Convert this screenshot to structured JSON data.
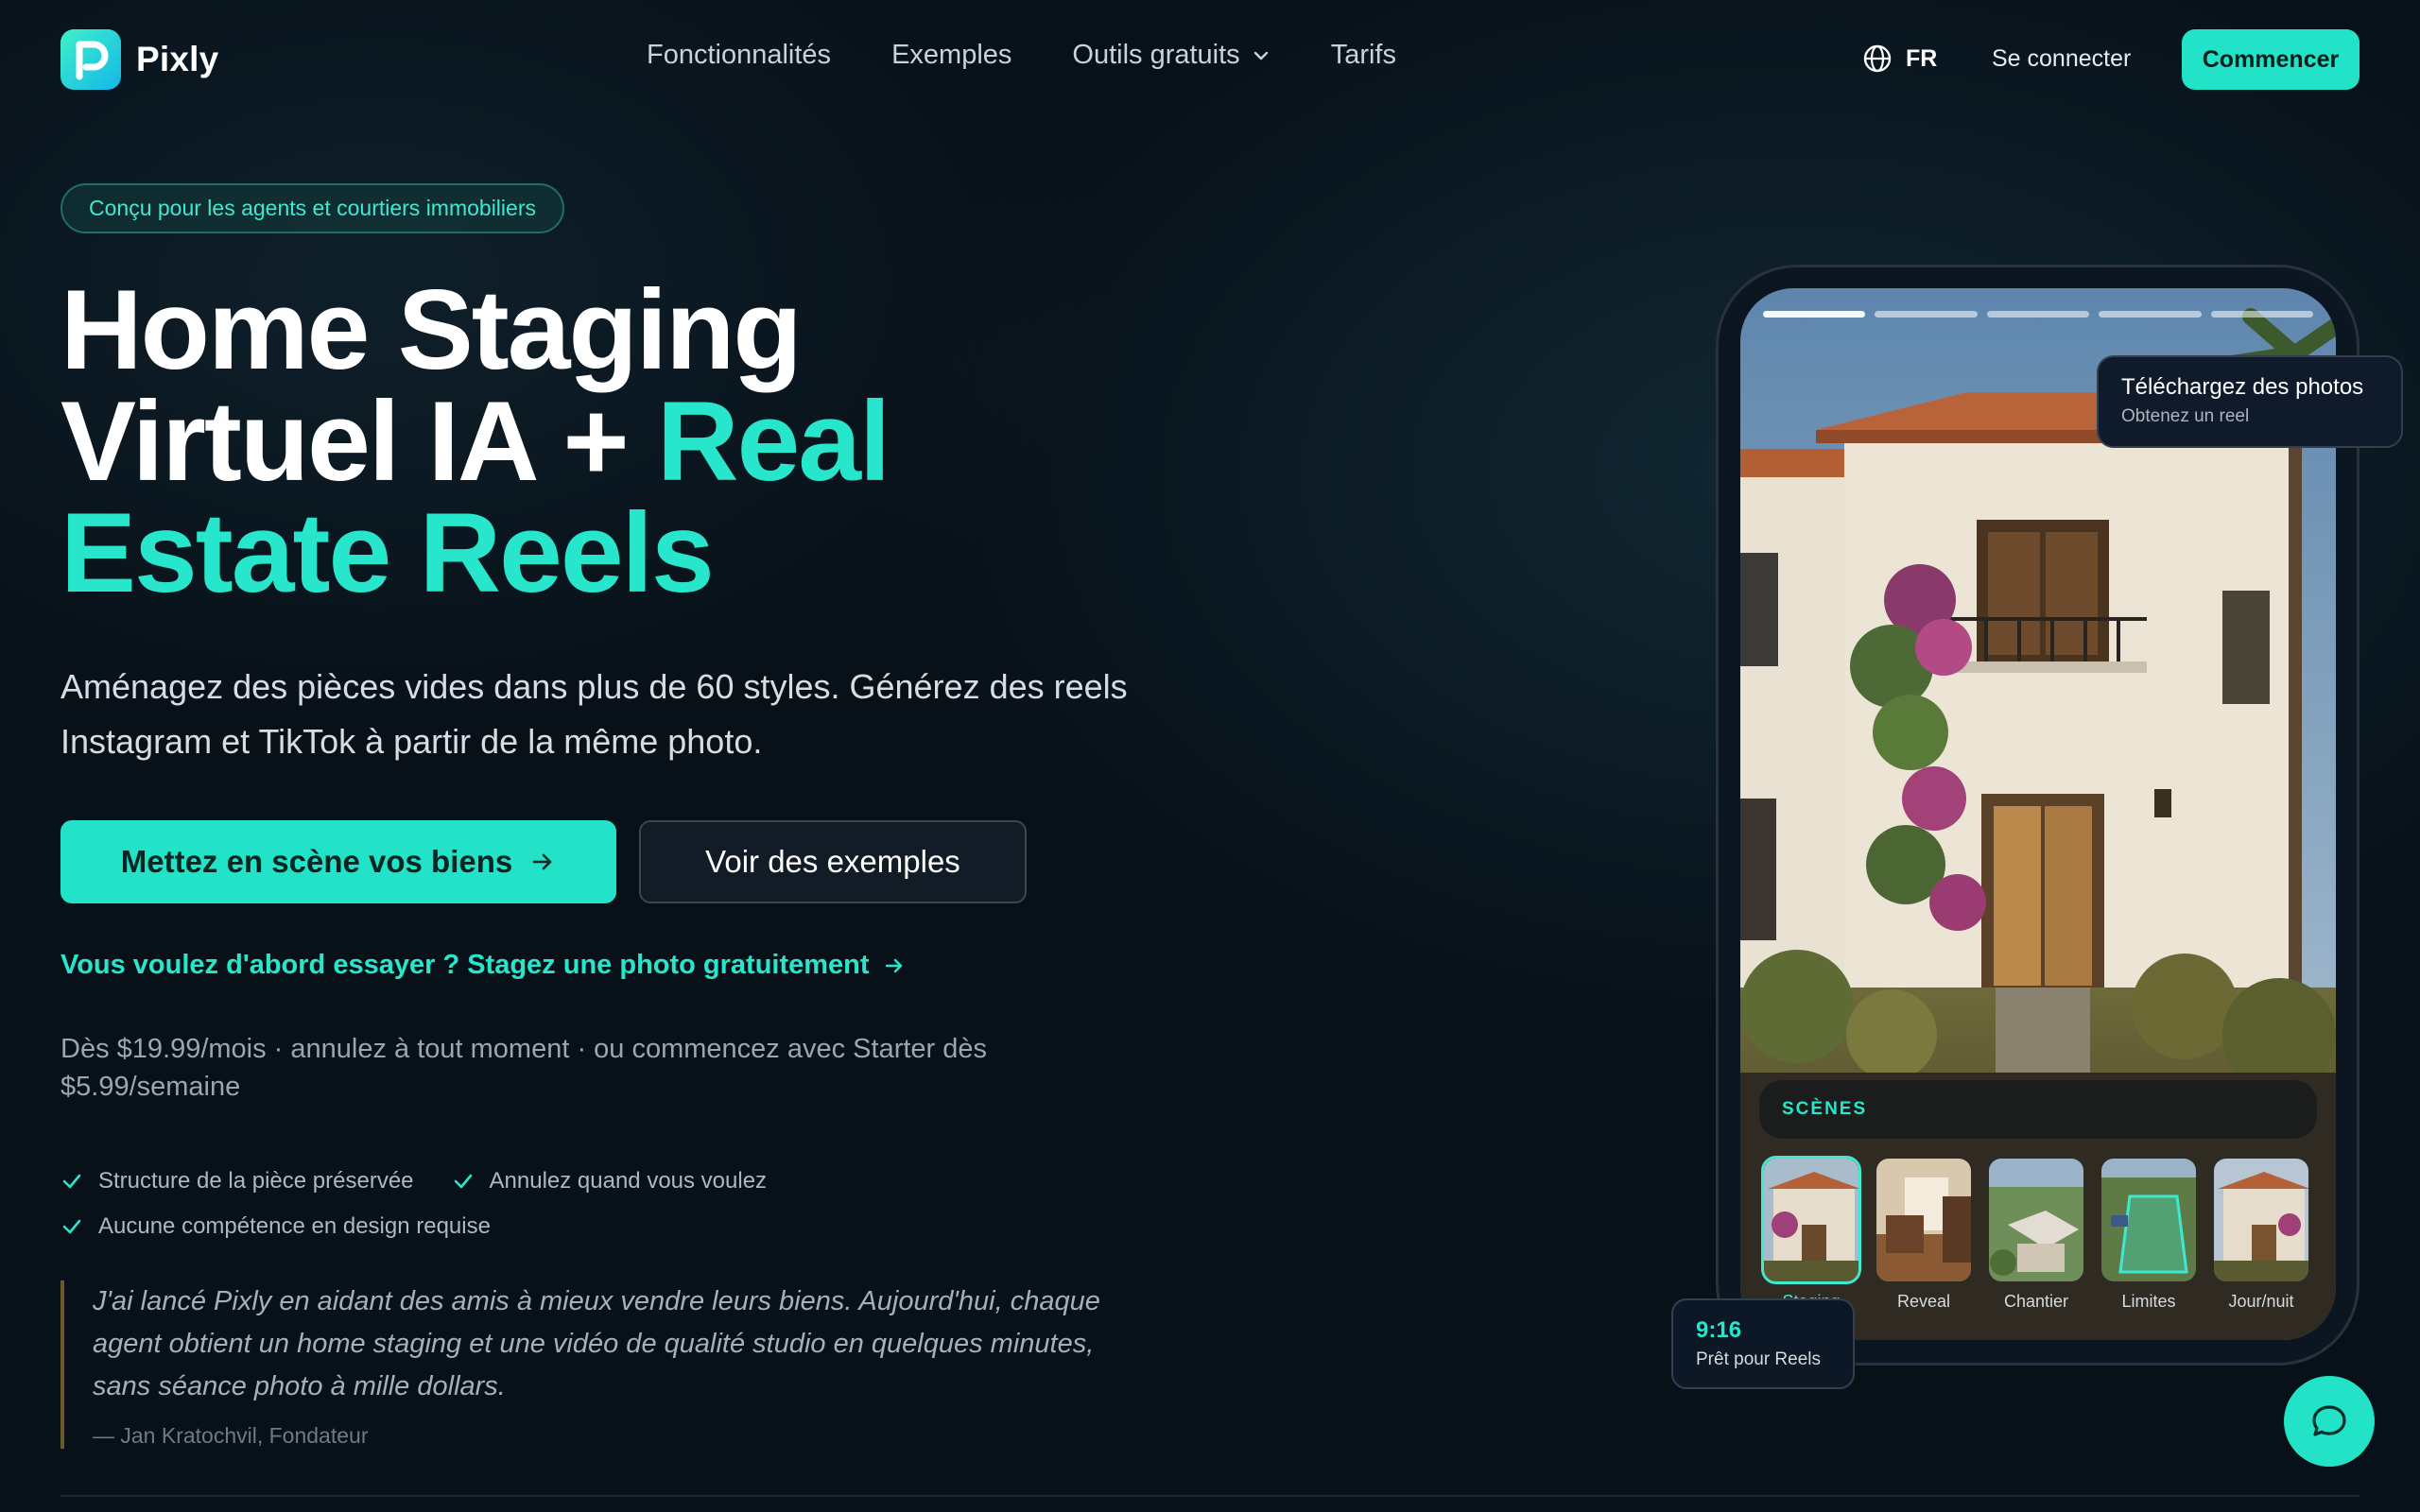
{
  "brand": {
    "name": "Pixly"
  },
  "nav": {
    "links": [
      "Fonctionnalités",
      "Exemples",
      "Outils gratuits",
      "Tarifs"
    ],
    "language": "FR",
    "signin": "Se connecter",
    "start": "Commencer"
  },
  "hero": {
    "badge": "Conçu pour les agents et courtiers immobiliers",
    "title_line1": "Home Staging",
    "title_line2a": "Virtuel IA + ",
    "title_line2b": "Real",
    "title_line3": "Estate Reels",
    "lead": "Aménagez des pièces vides dans plus de 60 styles. Générez des reels Instagram et TikTok à partir de la même photo.",
    "cta_primary": "Mettez en scène vos biens",
    "cta_secondary": "Voir des exemples",
    "try_link": "Vous voulez d'abord essayer ? Stagez une photo gratuitement",
    "pricing": "Dès $19.99/mois · annulez à tout moment · ou commencez avec Starter dès $5.99/semaine",
    "checks": [
      "Structure de la pièce préservée",
      "Annulez quand vous voulez",
      "Aucune compétence en design requise"
    ],
    "quote": "J'ai lancé Pixly en aidant des amis à mieux vendre leurs biens. Aujourd'hui, chaque agent obtient un home staging et une vidéo de qualité studio en quelques minutes, sans séance photo à mille dollars.",
    "quote_author": "— Jan Kratochvil, Fondateur"
  },
  "phone": {
    "scenes_label": "SCÈNES",
    "scenes": [
      "Staging",
      "Reveal",
      "Chantier",
      "Limites",
      "Jour/nuit"
    ],
    "active_scene": "Staging",
    "tooltip_title": "Téléchargez des photos",
    "tooltip_sub": "Obtenez un reel",
    "ratio": "9:16",
    "ratio_sub": "Prêt pour Reels"
  },
  "colors": {
    "accent": "#22e2c8",
    "background": "#081018"
  },
  "icons": [
    "globe-icon",
    "chevron-down-icon",
    "arrow-right-icon",
    "check-icon",
    "chat-icon"
  ]
}
